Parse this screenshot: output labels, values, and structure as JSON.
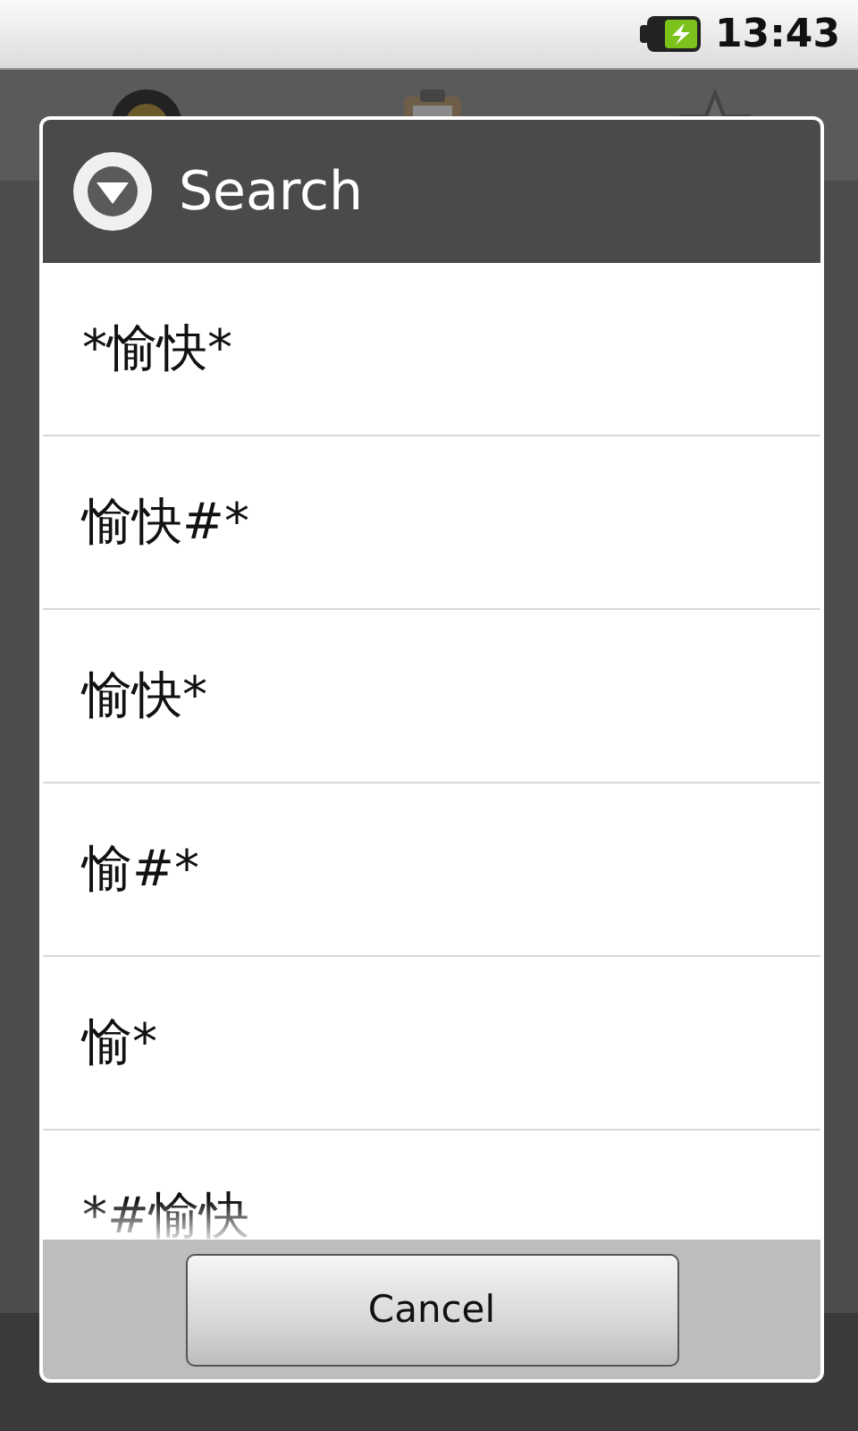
{
  "status_bar": {
    "time": "13:43"
  },
  "dialog": {
    "title": "Search",
    "items": [
      "*愉快*",
      "愉快#*",
      "愉快*",
      "愉#*",
      "愉*",
      "*#愉快"
    ],
    "buttons": [
      "Cancel"
    ]
  }
}
